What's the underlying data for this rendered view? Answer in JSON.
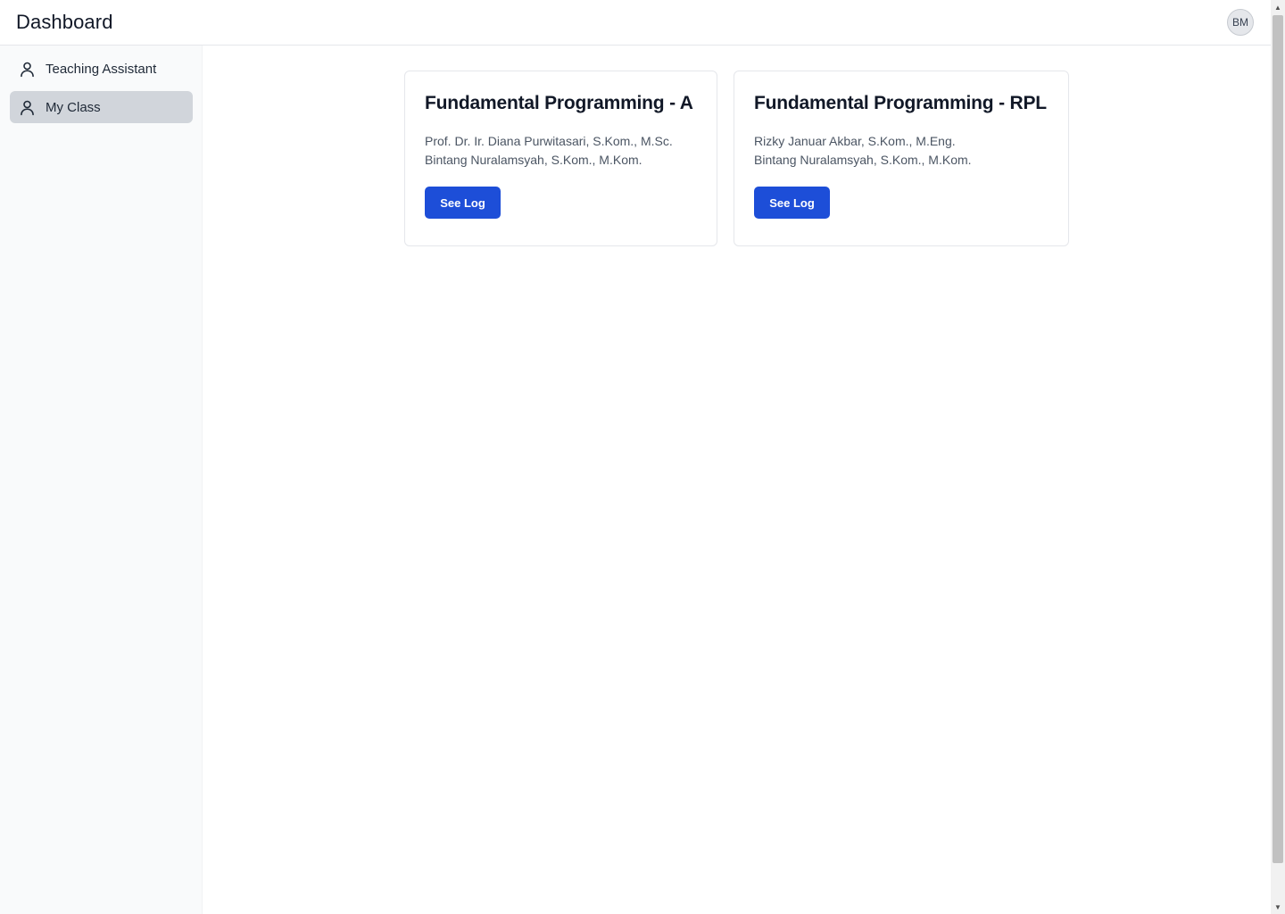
{
  "header": {
    "title": "Dashboard",
    "avatar_initials": "BM"
  },
  "sidebar": {
    "items": [
      {
        "label": "Teaching Assistant",
        "icon": "user-icon",
        "active": false
      },
      {
        "label": "My Class",
        "icon": "user-icon",
        "active": true
      }
    ]
  },
  "classes": [
    {
      "title": "Fundamental Programming - A",
      "lecturers": [
        "Prof. Dr. Ir. Diana Purwitasari, S.Kom., M.Sc.",
        "Bintang Nuralamsyah, S.Kom., M.Kom."
      ],
      "button_label": "See Log"
    },
    {
      "title": "Fundamental Programming - RPL",
      "lecturers": [
        "Rizky Januar Akbar, S.Kom., M.Eng.",
        "Bintang Nuralamsyah, S.Kom., M.Kom."
      ],
      "button_label": "See Log"
    }
  ],
  "colors": {
    "primary_button": "#1d4ed8",
    "sidebar_bg": "#f9fafb",
    "active_item_bg": "#d1d5db"
  },
  "scrollbar": {
    "up_arrow": "▲",
    "down_arrow": "▼"
  }
}
